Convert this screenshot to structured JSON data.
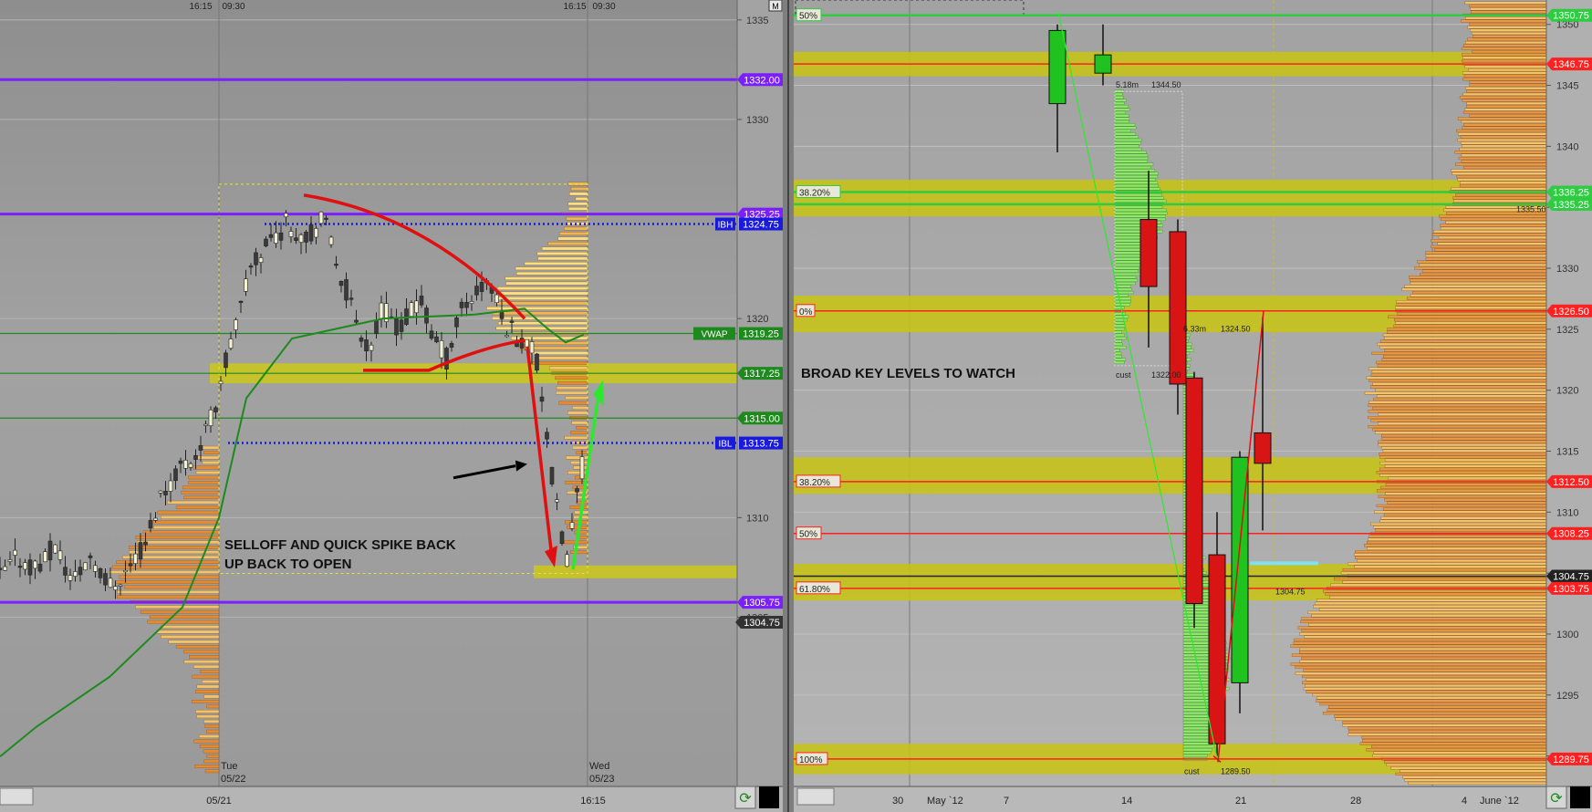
{
  "chart_data": [
    {
      "type": "candlestick",
      "name": "",
      "y_range": [
        1296.5,
        1336
      ],
      "y_ticks": [
        1305,
        1310,
        1320,
        1330,
        1335
      ],
      "time_axis_top": [
        "16:15",
        "09:30",
        "16:15",
        "09:30"
      ],
      "x_axis_labels": [
        "05/21",
        "16:15"
      ],
      "session_labels": [
        {
          "day": "Tue",
          "date": "05/22"
        },
        {
          "day": "Wed",
          "date": "05/23"
        }
      ],
      "levels": [
        {
          "label": "1332.00",
          "value": 1332.0,
          "color": "#7b1fff"
        },
        {
          "label": "1325.25",
          "value": 1325.25,
          "color": "#7b1fff"
        },
        {
          "label": "IBH",
          "value": 1324.75,
          "color": "#1a1adc",
          "price": "1324.75"
        },
        {
          "label": "VWAP",
          "value": 1319.25,
          "color": "#1e8a1e",
          "price": "1319.25"
        },
        {
          "label": "1317.25",
          "value": 1317.25,
          "color": "#1e8a1e"
        },
        {
          "label": "1315.00",
          "value": 1315.0,
          "color": "#1e8a1e"
        },
        {
          "label": "IBL",
          "value": 1313.75,
          "color": "#1a1adc",
          "price": "1313.75"
        },
        {
          "label": "1305.75",
          "value": 1305.75,
          "color": "#7b1fff"
        }
      ],
      "last_price": "1304.75",
      "zones": [
        {
          "from": 1316.75,
          "to": 1317.75
        },
        {
          "from": 1307.0,
          "to": 1307.6
        }
      ],
      "annotation": "SELLOFF AND QUICK SPIKE BACK\nUP BACK TO OPEN",
      "grid": true
    },
    {
      "type": "candlestick",
      "name": "",
      "y_range": [
        1287.5,
        1352
      ],
      "y_ticks": [
        1290,
        1295,
        1300,
        1305,
        1310,
        1315,
        1320,
        1325,
        1330,
        1335,
        1340,
        1345,
        1350
      ],
      "x_axis_labels": [
        "30",
        "May `12",
        "7",
        "14",
        "21",
        "28",
        "4",
        "June `12"
      ],
      "candles": [
        {
          "date": "May 10",
          "open": 1343.5,
          "high": 1350.0,
          "low": 1339.5,
          "close": 1349.5
        },
        {
          "date": "May 11",
          "open": 1346.0,
          "high": 1350.0,
          "low": 1345.0,
          "close": 1347.5
        },
        {
          "date": "May 15",
          "open": 1334.0,
          "high": 1338.0,
          "low": 1323.5,
          "close": 1328.5
        },
        {
          "date": "May 16",
          "open": 1333.0,
          "high": 1334.0,
          "low": 1318.0,
          "close": 1320.5
        },
        {
          "date": "May 17",
          "open": 1321.0,
          "high": 1321.5,
          "low": 1300.5,
          "close": 1302.5
        },
        {
          "date": "May 18",
          "open": 1306.5,
          "high": 1310.0,
          "low": 1290.0,
          "close": 1291.0
        },
        {
          "date": "May 21",
          "open": 1296.0,
          "high": 1315.0,
          "low": 1293.5,
          "close": 1314.5
        },
        {
          "date": "May 22",
          "open": 1316.5,
          "high": 1326.0,
          "low": 1308.5,
          "close": 1314.0
        }
      ],
      "levels": [
        {
          "label": "1350.75",
          "value": 1350.75,
          "color": "#2ecc40",
          "fib": "50%"
        },
        {
          "label": "1346.75",
          "value": 1346.75,
          "color": "#ff2020",
          "fib": ""
        },
        {
          "label": "1336.25",
          "value": 1336.25,
          "color": "#2ecc40",
          "fib": "38.20%"
        },
        {
          "label": "1335.25",
          "value": 1335.25,
          "color": "#2ecc40",
          "fib": ""
        },
        {
          "label": "1326.50",
          "value": 1326.5,
          "color": "#ff2020",
          "fib": "0%"
        },
        {
          "label": "1312.50",
          "value": 1312.5,
          "color": "#ff2020",
          "fib": "38.20%"
        },
        {
          "label": "1308.25",
          "value": 1308.25,
          "color": "#ff2020",
          "fib": "50%"
        },
        {
          "label": "1304.75",
          "value": 1304.75,
          "color": "#222222",
          "fib": ""
        },
        {
          "label": "1303.75",
          "value": 1303.75,
          "color": "#ff2020",
          "fib": "61.80%"
        },
        {
          "label": "1289.75",
          "value": 1289.75,
          "color": "#ff2020",
          "fib": "100%"
        }
      ],
      "profile_labels": [
        {
          "text": "5.18m",
          "value": 1344.5
        },
        {
          "text": "1344.50",
          "value": 1344.5
        },
        {
          "text": "6.33m",
          "value": 1324.5
        },
        {
          "text": "1324.50",
          "value": 1324.5
        },
        {
          "text": "1322.00",
          "value": 1322.0
        },
        {
          "text": "cust",
          "value": 1322.0
        },
        {
          "text": "1289.50",
          "value": 1289.5
        },
        {
          "text": "cust",
          "value": 1289.5
        },
        {
          "text": "1304.75",
          "value": 1304.0
        },
        {
          "text": "1335.50",
          "value": 1335.5
        }
      ],
      "annotation": "BROAD KEY LEVELS TO WATCH",
      "grid": true
    }
  ],
  "ui": {
    "refresh_icon": "refresh-icon",
    "maximize_label": "M"
  },
  "colors": {
    "up": "#1fc21f",
    "down": "#d81414",
    "purple": "#7b1fff",
    "zone": "#c6c316",
    "profile_orange": "#e88930",
    "profile_green": "#8ee86b"
  }
}
